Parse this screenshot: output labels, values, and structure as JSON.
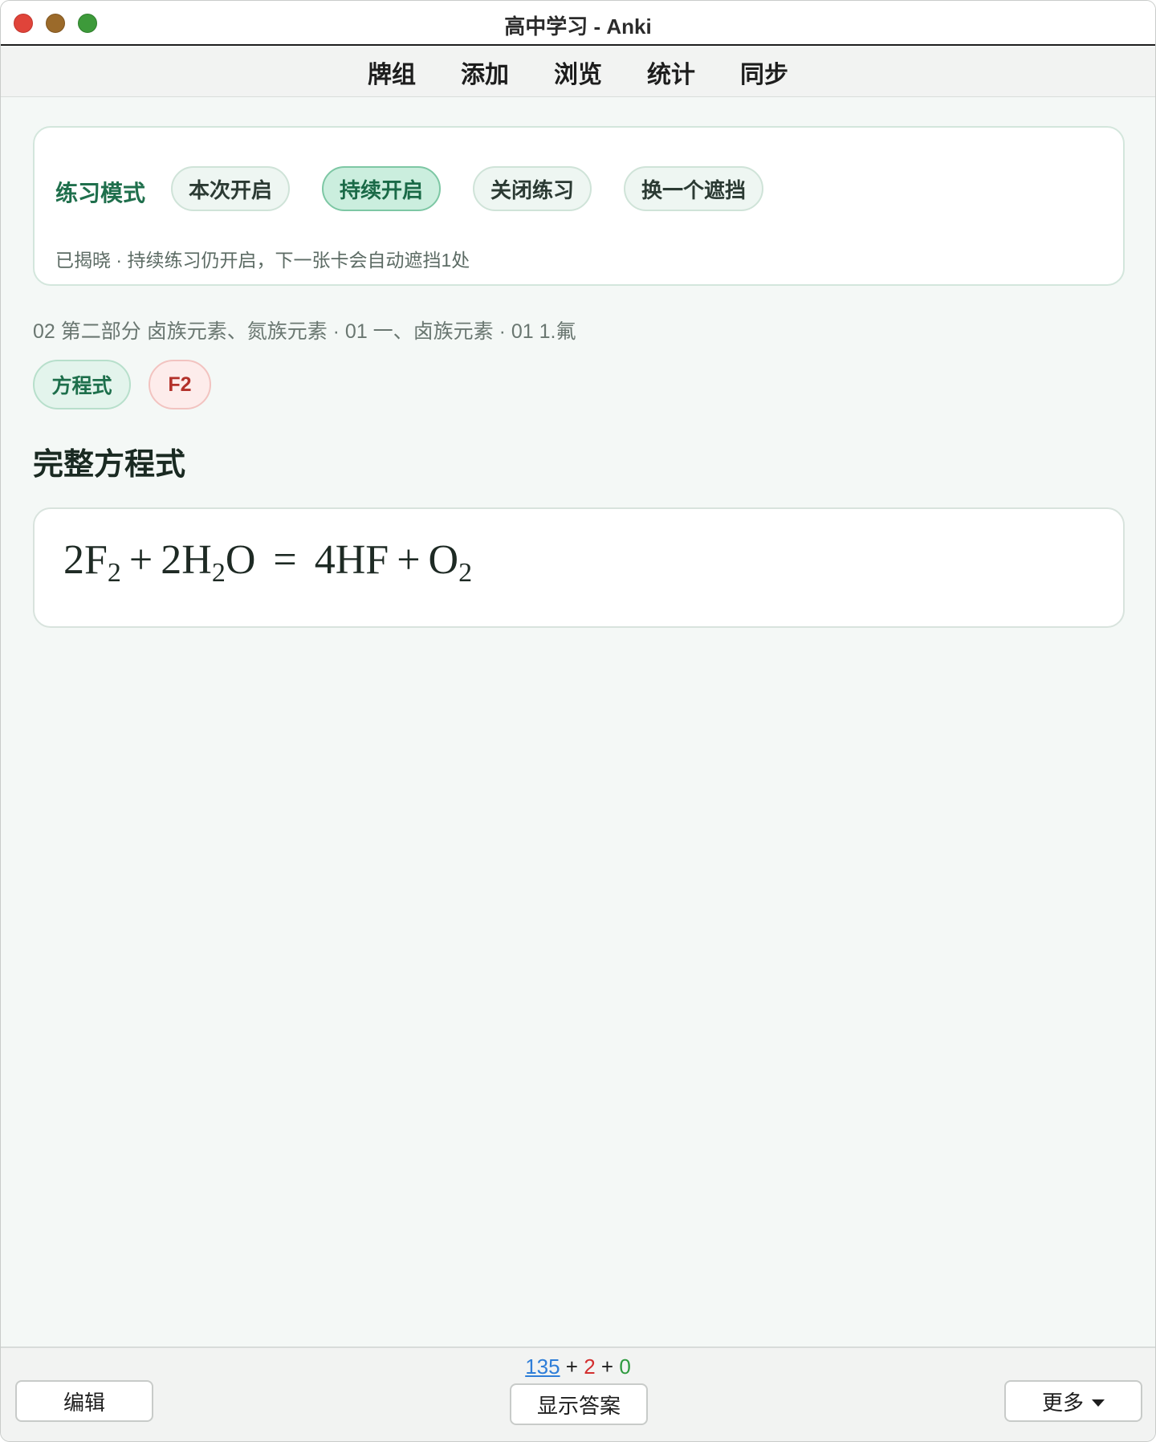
{
  "window": {
    "title": "高中学习 - Anki"
  },
  "toolbar": {
    "items": [
      {
        "label": "牌组"
      },
      {
        "label": "添加"
      },
      {
        "label": "浏览"
      },
      {
        "label": "统计"
      },
      {
        "label": "同步"
      }
    ]
  },
  "practice": {
    "label": "练习模式",
    "options": [
      {
        "label": "本次开启",
        "active": false
      },
      {
        "label": "持续开启",
        "active": true
      },
      {
        "label": "关闭练习",
        "active": false
      },
      {
        "label": "换一个遮挡",
        "active": false
      }
    ],
    "status": "已揭晓 · 持续练习仍开启，下一张卡会自动遮挡1处"
  },
  "card": {
    "breadcrumb": "02 第二部分 卤族元素、氮族元素 · 01 一、卤族元素 · 01 1.氟",
    "tags": [
      {
        "label": "方程式"
      },
      {
        "label": "F2"
      }
    ],
    "heading": "完整方程式",
    "equation": {
      "lhs1_coef": "2",
      "lhs1_el": "F",
      "lhs1_sub": "2",
      "plus1": "+",
      "lhs2_coef": "2",
      "lhs2_el1": "H",
      "lhs2_sub": "2",
      "lhs2_el2": "O",
      "equals": "=",
      "rhs1": "4HF",
      "plus2": "+",
      "rhs2_el": "O",
      "rhs2_sub": "2"
    }
  },
  "bottombar": {
    "counts": {
      "new": "135",
      "sep1": " + ",
      "learn": "2",
      "sep2": " + ",
      "review": "0"
    },
    "edit_label": "编辑",
    "show_answer_label": "显示答案",
    "more_label": "更多"
  },
  "colors": {
    "accent_green": "#1f6f4c",
    "new_count": "#2f7ed8",
    "learn_count": "#d32f2f",
    "review_count": "#2e9a3e",
    "tag_red": "#b3312a"
  }
}
